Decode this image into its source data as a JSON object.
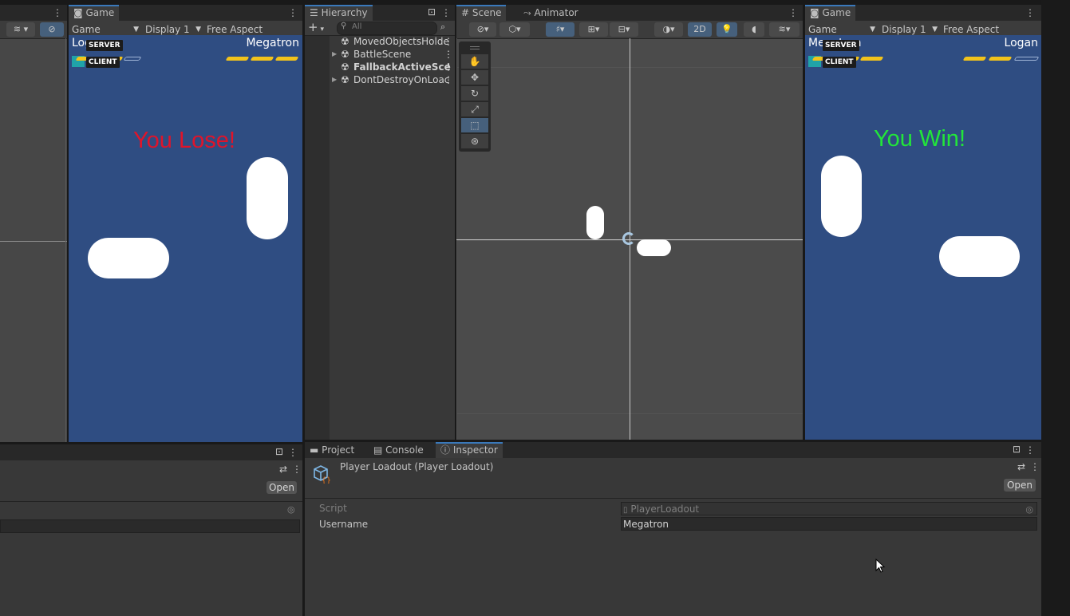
{
  "left_game": {
    "tab": "Game",
    "toolbar": {
      "view": "Game",
      "display": "Display 1",
      "aspect": "Free Aspect"
    },
    "player_left": "Logan",
    "player_right": "Megatron",
    "server_tag": "SERVER",
    "client_tag": "CLIENT",
    "result": "You Lose!",
    "result_color": "#e0142a",
    "left_health_bars_filled": 2,
    "right_health_bars_filled": 3
  },
  "right_game": {
    "tab": "Game",
    "toolbar": {
      "view": "Game",
      "display": "Display 1",
      "aspect": "Free Aspect"
    },
    "player_left": "Megatron",
    "player_right": "Logan",
    "server_tag": "SERVER",
    "client_tag": "CLIENT",
    "result": "You Win!",
    "result_color": "#22e53a",
    "left_health_bars_filled": 3,
    "right_health_bars_filled": 2
  },
  "hierarchy": {
    "tab": "Hierarchy",
    "search_placeholder": "All",
    "items": [
      {
        "label": "MovedObjectsHolde",
        "expandable": false
      },
      {
        "label": "BattleScene",
        "expandable": true
      },
      {
        "label": "FallbackActiveSce",
        "expandable": false
      },
      {
        "label": "DontDestroyOnLoac",
        "expandable": true
      }
    ]
  },
  "scene": {
    "tabs": [
      "Scene",
      "Animator"
    ],
    "mode_2d": "2D"
  },
  "left_inspector": {
    "open_button": "Open"
  },
  "bottom_panel": {
    "tabs": [
      "Project",
      "Console",
      "Inspector"
    ],
    "header_title": "Player Loadout (Player Loadout)",
    "open_button": "Open",
    "fields": [
      {
        "label": "Script",
        "value": "PlayerLoadout",
        "disabled": true
      },
      {
        "label": "Username",
        "value": "Megatron",
        "disabled": false
      }
    ]
  },
  "colors": {
    "accent_blue": "#3a79bb",
    "game_background": "#2f4d82",
    "health_bar": "#f2c31b"
  }
}
